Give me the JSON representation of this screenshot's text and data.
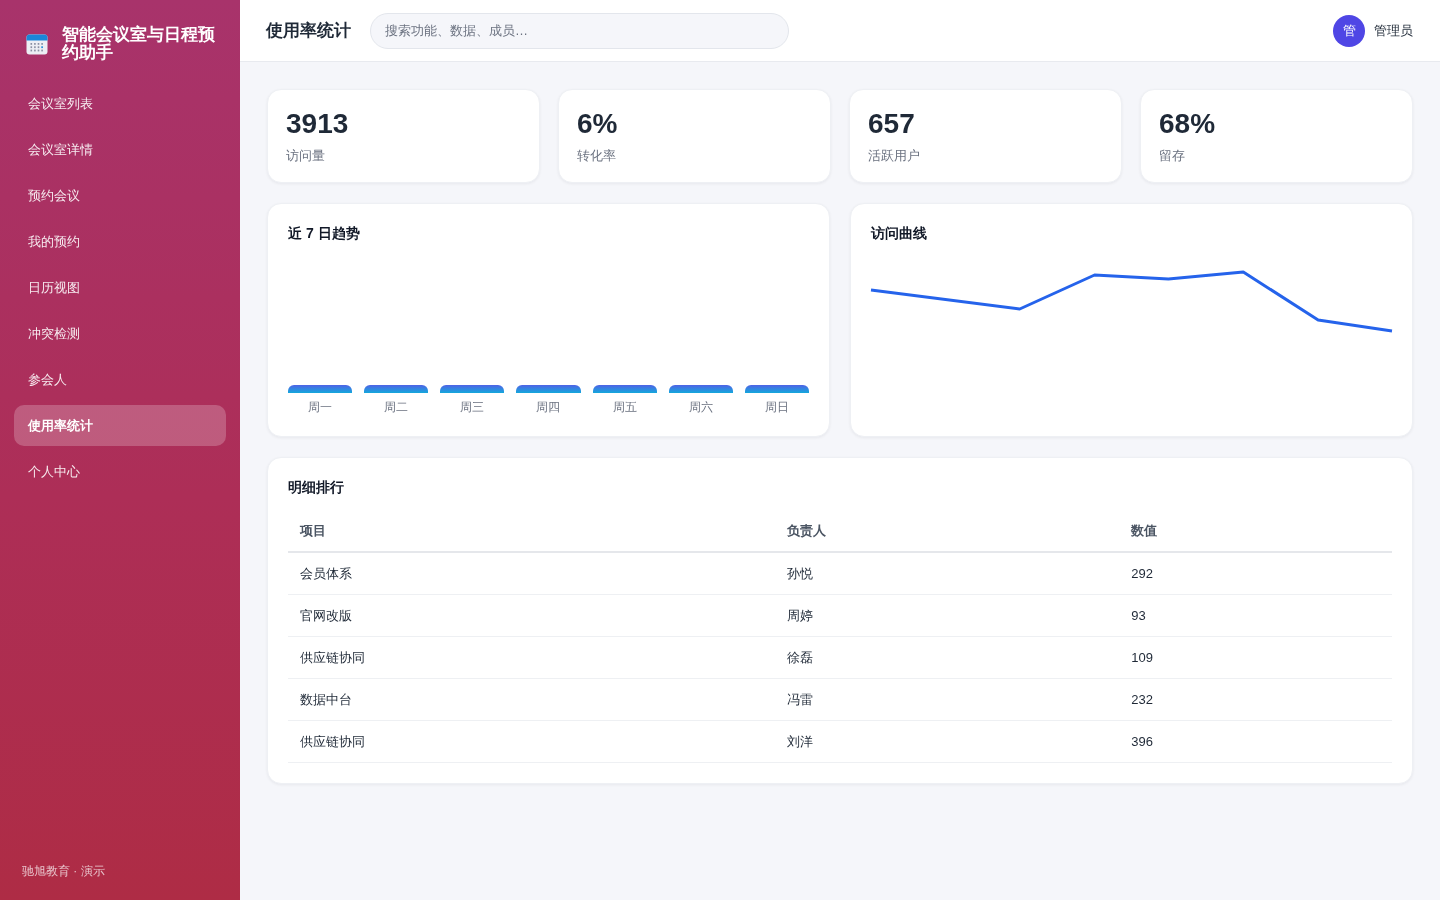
{
  "sidebar": {
    "title": "智能会议室与日程预约助手",
    "items": [
      {
        "label": "会议室列表",
        "selected": false
      },
      {
        "label": "会议室详情",
        "selected": false
      },
      {
        "label": "预约会议",
        "selected": false
      },
      {
        "label": "我的预约",
        "selected": false
      },
      {
        "label": "日历视图",
        "selected": false
      },
      {
        "label": "冲突检测",
        "selected": false
      },
      {
        "label": "参会人",
        "selected": false
      },
      {
        "label": "使用率统计",
        "selected": true
      },
      {
        "label": "个人中心",
        "selected": false
      }
    ],
    "footer": "驰旭教育 · 演示"
  },
  "header": {
    "title": "使用率统计",
    "search": {
      "placeholder": "搜索功能、数据、成员…"
    },
    "user": {
      "avatar": "管",
      "name": "管理员"
    }
  },
  "stats": [
    {
      "value": "3913",
      "label": "访问量"
    },
    {
      "value": "6%",
      "label": "转化率"
    },
    {
      "value": "657",
      "label": "活跃用户"
    },
    {
      "value": "68%",
      "label": "留存"
    }
  ],
  "trend_card": {
    "title": "近 7 日趋势",
    "bar_labels": [
      "周一",
      "周二",
      "周三",
      "周四",
      "周五",
      "周六",
      "周日"
    ]
  },
  "curve_card": {
    "title": "访问曲线"
  },
  "ranking": {
    "title": "明细排行",
    "columns": [
      "项目",
      "负责人",
      "数值"
    ],
    "rows": [
      [
        "会员体系",
        "孙悦",
        "292"
      ],
      [
        "官网改版",
        "周婷",
        "93"
      ],
      [
        "供应链协同",
        "徐磊",
        "109"
      ],
      [
        "数据中台",
        "冯雷",
        "232"
      ],
      [
        "供应链协同",
        "刘洋",
        "396"
      ]
    ]
  }
}
